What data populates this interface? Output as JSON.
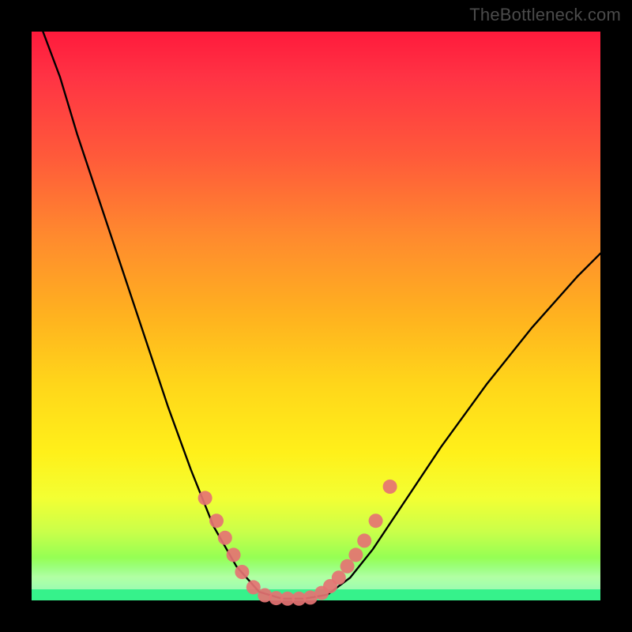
{
  "watermark": "TheBottleneck.com",
  "chart_data": {
    "type": "line",
    "title": "",
    "xlabel": "",
    "ylabel": "",
    "xlim": [
      0,
      100
    ],
    "ylim": [
      0,
      100
    ],
    "grid": false,
    "curve": {
      "description": "Asymmetric V-shaped bottleneck curve. Left branch falls steeply from top-left to a flat trough near x≈40–50 at y≈0, right branch rises more slowly toward the upper-right corner ending near y≈60.",
      "points": [
        {
          "x": 2,
          "y": 100
        },
        {
          "x": 5,
          "y": 92
        },
        {
          "x": 8,
          "y": 82
        },
        {
          "x": 12,
          "y": 70
        },
        {
          "x": 16,
          "y": 58
        },
        {
          "x": 20,
          "y": 46
        },
        {
          "x": 24,
          "y": 34
        },
        {
          "x": 28,
          "y": 23
        },
        {
          "x": 32,
          "y": 13
        },
        {
          "x": 36,
          "y": 6
        },
        {
          "x": 40,
          "y": 1.5
        },
        {
          "x": 44,
          "y": 0.3
        },
        {
          "x": 48,
          "y": 0.3
        },
        {
          "x": 52,
          "y": 1.0
        },
        {
          "x": 56,
          "y": 4
        },
        {
          "x": 60,
          "y": 9
        },
        {
          "x": 66,
          "y": 18
        },
        {
          "x": 72,
          "y": 27
        },
        {
          "x": 80,
          "y": 38
        },
        {
          "x": 88,
          "y": 48
        },
        {
          "x": 96,
          "y": 57
        },
        {
          "x": 100,
          "y": 61
        }
      ]
    },
    "markers": {
      "description": "Salmon-pink dots clustered around the trough and lower arms of the curve.",
      "points": [
        {
          "x": 30.5,
          "y": 18
        },
        {
          "x": 32.5,
          "y": 14
        },
        {
          "x": 34,
          "y": 11
        },
        {
          "x": 35.5,
          "y": 8
        },
        {
          "x": 37,
          "y": 5
        },
        {
          "x": 39,
          "y": 2.3
        },
        {
          "x": 41,
          "y": 0.9
        },
        {
          "x": 43,
          "y": 0.4
        },
        {
          "x": 45,
          "y": 0.3
        },
        {
          "x": 47,
          "y": 0.3
        },
        {
          "x": 49,
          "y": 0.5
        },
        {
          "x": 51,
          "y": 1.3
        },
        {
          "x": 52.5,
          "y": 2.5
        },
        {
          "x": 54,
          "y": 4
        },
        {
          "x": 55.5,
          "y": 6
        },
        {
          "x": 57,
          "y": 8
        },
        {
          "x": 58.5,
          "y": 10.5
        },
        {
          "x": 60.5,
          "y": 14
        },
        {
          "x": 63,
          "y": 20
        }
      ],
      "radius": 9
    },
    "colors": {
      "curve": "#000000",
      "markers": "#e57373",
      "gradient_top": "#ff1a3c",
      "gradient_bottom": "#00e06a"
    }
  }
}
